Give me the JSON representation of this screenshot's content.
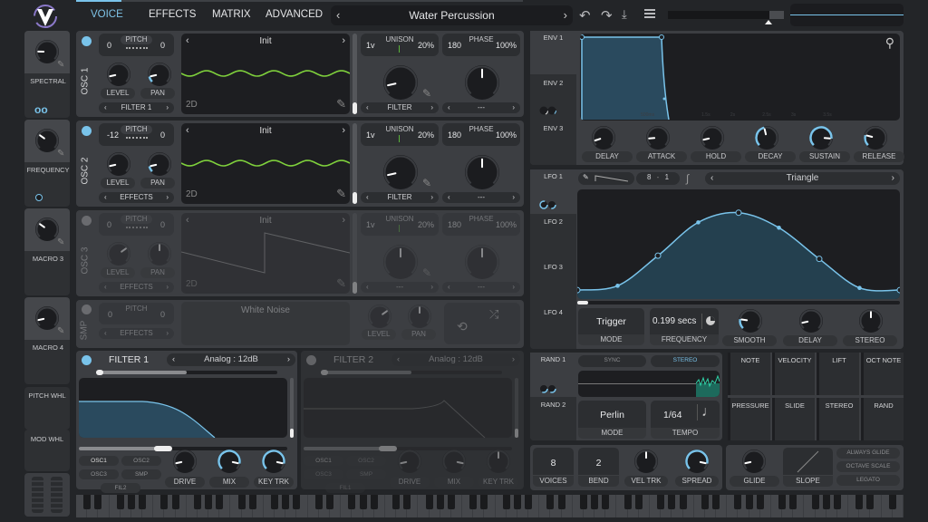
{
  "colors": {
    "accent": "#79c3ea",
    "wave": "#7fd13c",
    "random": "#2fd3a8",
    "background": "#232528",
    "panel": "#3c3e42"
  },
  "header": {
    "logo": "V",
    "tabs": [
      "VOICE",
      "EFFECTS",
      "MATRIX",
      "ADVANCED"
    ],
    "active_tab": "VOICE",
    "preset": "Water Percussion",
    "icons": [
      "undo-icon",
      "redo-icon",
      "save-icon",
      "menu-icon"
    ]
  },
  "macros": [
    {
      "label": "SPECTRAL",
      "value": 0.17,
      "arc": false
    },
    {
      "label": "FREQUENCY",
      "value": 0.3,
      "arc": false
    },
    {
      "label": "MACRO 3",
      "value": 0.3,
      "arc": false
    },
    {
      "label": "MACRO 4",
      "value": 0.12,
      "arc": false
    }
  ],
  "wheels": {
    "pitch": "PITCH WHL",
    "mod": "MOD WHL"
  },
  "oscillators": [
    {
      "name": "OSC 1",
      "enabled": true,
      "pitch_label": "PITCH",
      "transpose": "0",
      "tune": "0",
      "level_label": "LEVEL",
      "pan_label": "PAN",
      "level": 0.12,
      "pan": 0.12,
      "destination": "FILTER 1",
      "wavetable": "Init",
      "view": "2D",
      "unison_label": "UNISON",
      "unison_voices": "1v",
      "unison_detune": "20%",
      "phase_label": "PHASE",
      "phase": "180",
      "phase_random": "100%",
      "unison_knob": 0.12,
      "phase_knob": 0.5,
      "left_mode": "FILTER",
      "right_mode": "---",
      "wave": "sine"
    },
    {
      "name": "OSC 2",
      "enabled": true,
      "pitch_label": "PITCH",
      "transpose": "-12",
      "tune": "0",
      "level_label": "LEVEL",
      "pan_label": "PAN",
      "level": 0.12,
      "pan": 0.12,
      "destination": "EFFECTS",
      "wavetable": "Init",
      "view": "2D",
      "unison_label": "UNISON",
      "unison_voices": "1v",
      "unison_detune": "20%",
      "phase_label": "PHASE",
      "phase": "180",
      "phase_random": "100%",
      "unison_knob": 0.12,
      "phase_knob": 0.5,
      "left_mode": "FILTER",
      "right_mode": "---",
      "wave": "sine"
    },
    {
      "name": "OSC 3",
      "enabled": false,
      "pitch_label": "PITCH",
      "transpose": "0",
      "tune": "0",
      "level_label": "LEVEL",
      "pan_label": "PAN",
      "level": 0.7,
      "pan": 0.5,
      "destination": "EFFECTS",
      "wavetable": "Init",
      "view": "2D",
      "unison_label": "UNISON",
      "unison_voices": "1v",
      "unison_detune": "20%",
      "phase_label": "PHASE",
      "phase": "180",
      "phase_random": "100%",
      "unison_knob": 0.5,
      "phase_knob": 0.5,
      "left_mode": "---",
      "right_mode": "---",
      "wave": "saw"
    }
  ],
  "sampler": {
    "name": "SMP",
    "enabled": false,
    "pitch_label": "PITCH",
    "transpose": "0",
    "tune": "0",
    "sample": "White Noise",
    "destination": "EFFECTS",
    "level_label": "LEVEL",
    "pan_label": "PAN",
    "level": 0.7,
    "pan": 0.5
  },
  "filters": [
    {
      "name": "FILTER 1",
      "enabled": true,
      "model": "Analog : 12dB",
      "routes": [
        "OSC1",
        "OSC2",
        "OSC3",
        "SMP",
        "FIL2"
      ],
      "knobs": [
        {
          "label": "DRIVE",
          "value": 0.12,
          "arc": false
        },
        {
          "label": "MIX",
          "value": 0.88,
          "arc": true
        },
        {
          "label": "KEY TRK",
          "value": 0.88,
          "arc": true
        }
      ]
    },
    {
      "name": "FILTER 2",
      "enabled": false,
      "model": "Analog : 12dB",
      "routes": [
        "OSC1",
        "OSC2",
        "OSC3",
        "SMP",
        "FIL1"
      ],
      "knobs": [
        {
          "label": "DRIVE",
          "value": 0.12,
          "arc": false
        },
        {
          "label": "MIX",
          "value": 0.88,
          "arc": false
        },
        {
          "label": "KEY TRK",
          "value": 0.5,
          "arc": false
        }
      ]
    }
  ],
  "envelopes": {
    "tabs": [
      "ENV 1",
      "ENV 2",
      "ENV 3"
    ],
    "time_marks": [
      "500ms",
      "1.5s",
      "2s",
      "2.5s",
      "3s",
      "3.5s"
    ],
    "knobs": [
      {
        "label": "DELAY",
        "value": 0.1,
        "arc": false
      },
      {
        "label": "ATTACK",
        "value": 0.15,
        "arc": false
      },
      {
        "label": "HOLD",
        "value": 0.12,
        "arc": false
      },
      {
        "label": "DECAY",
        "value": 0.45,
        "arc": true
      },
      {
        "label": "SUSTAIN",
        "value": 0.85,
        "arc": true
      },
      {
        "label": "RELEASE",
        "value": 0.22,
        "arc": true
      }
    ]
  },
  "lfos": {
    "tabs": [
      "LFO 1",
      "LFO 2",
      "LFO 3",
      "LFO 4"
    ],
    "grid_x": "8",
    "grid_sep": "-",
    "grid_y": "1",
    "shape": "Triangle",
    "shape_points": [
      [
        0,
        0.05
      ],
      [
        0.125,
        0.09
      ],
      [
        0.25,
        0.37
      ],
      [
        0.375,
        0.68
      ],
      [
        0.5,
        0.77
      ],
      [
        0.625,
        0.63
      ],
      [
        0.75,
        0.34
      ],
      [
        0.875,
        0.07
      ],
      [
        1,
        0.05
      ]
    ],
    "mode": "Trigger",
    "mode_label": "MODE",
    "frequency": "0.199 secs",
    "frequency_label": "FREQUENCY",
    "knobs": [
      {
        "label": "SMOOTH",
        "value": 0.2,
        "arc": true
      },
      {
        "label": "DELAY",
        "value": 0.12,
        "arc": false
      },
      {
        "label": "STEREO",
        "value": 0.5,
        "arc": false
      }
    ]
  },
  "random": {
    "tabs": [
      "RAND 1",
      "RAND 2"
    ],
    "sync": "SYNC",
    "stereo": "STEREO",
    "mode": "Perlin",
    "mode_label": "MODE",
    "tempo": "1/64",
    "tempo_label": "TEMPO"
  },
  "mod_sources": [
    "NOTE",
    "VELOCITY",
    "LIFT",
    "OCT NOTE",
    "PRESSURE",
    "SLIDE",
    "STEREO",
    "RAND"
  ],
  "voice": {
    "voices": "8",
    "voices_label": "VOICES",
    "bend": "2",
    "bend_label": "BEND",
    "vel_trk_label": "VEL TRK",
    "vel_trk": 0.5,
    "spread_label": "SPREAD",
    "spread": 0.88
  },
  "glide": {
    "glide_label": "GLIDE",
    "glide": 0.12,
    "slope_label": "SLOPE",
    "buttons": [
      "ALWAYS GLIDE",
      "OCTAVE SCALE",
      "LEGATO"
    ]
  }
}
